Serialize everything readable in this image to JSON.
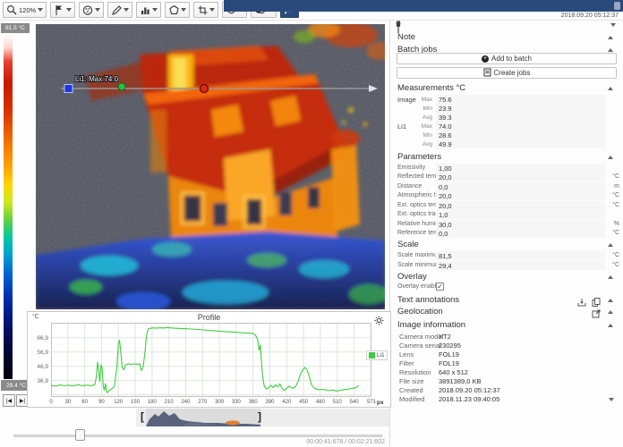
{
  "toolbar": {
    "zoom_value": "120%",
    "tools": [
      "zoom",
      "marker-flag",
      "palette",
      "pen",
      "histogram",
      "polygon",
      "crop",
      "rotate",
      "fade-overlay",
      "profile-chart"
    ]
  },
  "header": {
    "timestamp": "2018.09.20 05:12:37"
  },
  "scale_bar": {
    "max_label": "81.5 °C",
    "min_label": "29.4 °C"
  },
  "thermal_view": {
    "li1_label": "Li1: Max 74.0"
  },
  "transport": {
    "prev_label": "|◀",
    "next_label": "▶|",
    "time_label": "00:00:41:678 / 00:02:21:802",
    "bracket_left": "[",
    "bracket_right": "]"
  },
  "right_panel": {
    "note": {
      "title": "Note"
    },
    "batch_jobs": {
      "title": "Batch jobs",
      "add_label": "Add to batch",
      "create_label": "Create jobs"
    },
    "measurements": {
      "title": "Measurements °C",
      "rows": [
        {
          "name": "Image",
          "stat": "Max",
          "value": "75.6"
        },
        {
          "name": "",
          "stat": "Min",
          "value": "23.9"
        },
        {
          "name": "",
          "stat": "Avg",
          "value": "39.3"
        },
        {
          "name": "Li1",
          "stat": "Max",
          "value": "74.0"
        },
        {
          "name": "",
          "stat": "Min",
          "value": "28.6"
        },
        {
          "name": "",
          "stat": "Avg",
          "value": "49.9"
        }
      ]
    },
    "parameters": {
      "title": "Parameters",
      "rows": [
        {
          "label": "Emissivity",
          "value": "1,00",
          "unit": ""
        },
        {
          "label": "Reflected temp.",
          "value": "20,0",
          "unit": "°C"
        },
        {
          "label": "Distance",
          "value": "0,0",
          "unit": "m"
        },
        {
          "label": "Atmospheric temp.",
          "value": "20,0",
          "unit": "°C"
        },
        {
          "label": "Ext. optics temp.",
          "value": "20,0",
          "unit": "°C"
        },
        {
          "label": "Ext. optics trans.",
          "value": "1,0",
          "unit": ""
        },
        {
          "label": "Relative humidity",
          "value": "30,0",
          "unit": "%"
        },
        {
          "label": "Reference temp.",
          "value": "0,0",
          "unit": "°C"
        }
      ]
    },
    "scale": {
      "title": "Scale",
      "rows": [
        {
          "label": "Scale maximum",
          "value": "81,5",
          "unit": "°C"
        },
        {
          "label": "Scale minimum",
          "value": "29,4",
          "unit": "°C"
        }
      ]
    },
    "overlay": {
      "title": "Overlay",
      "checkbox_label": "Overlay enabled",
      "checked": true,
      "checkmark": "✓"
    },
    "text_annotations": {
      "title": "Text annotations"
    },
    "geolocation": {
      "title": "Geolocation"
    },
    "image_information": {
      "title": "Image information",
      "rows": [
        {
          "label": "Camera model",
          "value": "XT2"
        },
        {
          "label": "Camera serial",
          "value": "230295"
        },
        {
          "label": "Lens",
          "value": "FOL19"
        },
        {
          "label": "Filter",
          "value": "FOL19"
        },
        {
          "label": "Resolution",
          "value": "640 x 512"
        },
        {
          "label": "File size",
          "value": "3891389,0 KB"
        },
        {
          "label": "Created",
          "value": "2018.09.20 05:12:37"
        },
        {
          "label": "Modified",
          "value": "2018.11.23 09:40:05"
        }
      ]
    }
  },
  "chart_data": {
    "type": "line",
    "title": "Profile",
    "ylabel": "°C",
    "xlabel": "px",
    "grid": true,
    "legend_position": "right",
    "xlim": [
      0,
      571
    ],
    "ylim": [
      25.4,
      77.4
    ],
    "x_ticks": [
      0,
      30,
      60,
      90,
      120,
      150,
      180,
      210,
      240,
      270,
      300,
      330,
      360,
      390,
      420,
      450,
      480,
      510,
      540,
      571
    ],
    "y_ticks": [
      {
        "value": 66.9,
        "label": "66,9"
      },
      {
        "value": 56.9,
        "label": "56,9"
      },
      {
        "value": 46.9,
        "label": "46,9"
      },
      {
        "value": 36.9,
        "label": "36,9"
      }
    ],
    "y_grid": [
      26.9,
      36.9,
      46.9,
      56.9,
      66.9,
      76.9
    ],
    "series": [
      {
        "name": "Li1",
        "color": "#3fcc3f",
        "points": [
          [
            0,
            33.5
          ],
          [
            8,
            33
          ],
          [
            16,
            33.8
          ],
          [
            24,
            33.2
          ],
          [
            32,
            33.6
          ],
          [
            40,
            33.1
          ],
          [
            48,
            33.9
          ],
          [
            56,
            33.3
          ],
          [
            64,
            33.7
          ],
          [
            72,
            33.2
          ],
          [
            78,
            34
          ],
          [
            81,
            40
          ],
          [
            83,
            50
          ],
          [
            85,
            44
          ],
          [
            87,
            36
          ],
          [
            89,
            48
          ],
          [
            91,
            46
          ],
          [
            93,
            33
          ],
          [
            95,
            30
          ],
          [
            97,
            35
          ],
          [
            99,
            29
          ],
          [
            101,
            28.5
          ],
          [
            104,
            30
          ],
          [
            108,
            31
          ],
          [
            113,
            33
          ],
          [
            117,
            45
          ],
          [
            120,
            62
          ],
          [
            122,
            65.5
          ],
          [
            124,
            58
          ],
          [
            127,
            46
          ],
          [
            130,
            44.5
          ],
          [
            133,
            48
          ],
          [
            138,
            48.5
          ],
          [
            143,
            48.2
          ],
          [
            148,
            48.6
          ],
          [
            153,
            48.3
          ],
          [
            158,
            48.5
          ],
          [
            161,
            44
          ],
          [
            164,
            46
          ],
          [
            167,
            55
          ],
          [
            170,
            68
          ],
          [
            173,
            73
          ],
          [
            177,
            73.5
          ],
          [
            182,
            73.8
          ],
          [
            188,
            73.6
          ],
          [
            194,
            73.9
          ],
          [
            200,
            73.7
          ],
          [
            206,
            74
          ],
          [
            212,
            73.8
          ],
          [
            220,
            73.6
          ],
          [
            230,
            73.4
          ],
          [
            240,
            73.2
          ],
          [
            250,
            73
          ],
          [
            260,
            72.7
          ],
          [
            270,
            72.4
          ],
          [
            280,
            72.1
          ],
          [
            290,
            71.8
          ],
          [
            300,
            71.5
          ],
          [
            310,
            71.2
          ],
          [
            320,
            71
          ],
          [
            330,
            70.7
          ],
          [
            340,
            70.4
          ],
          [
            350,
            70.2
          ],
          [
            358,
            70
          ],
          [
            364,
            69
          ],
          [
            368,
            66
          ],
          [
            371,
            58
          ],
          [
            373,
            62
          ],
          [
            375,
            50
          ],
          [
            377,
            40
          ],
          [
            380,
            33
          ],
          [
            384,
            31
          ],
          [
            388,
            32
          ],
          [
            392,
            33.5
          ],
          [
            396,
            32
          ],
          [
            400,
            34
          ],
          [
            404,
            32.5
          ],
          [
            408,
            34.5
          ],
          [
            412,
            31
          ],
          [
            416,
            30
          ],
          [
            420,
            31.5
          ],
          [
            424,
            33
          ],
          [
            428,
            32
          ],
          [
            432,
            31.5
          ],
          [
            436,
            33
          ],
          [
            440,
            36
          ],
          [
            444,
            41
          ],
          [
            448,
            44
          ],
          [
            452,
            46
          ],
          [
            456,
            44.5
          ],
          [
            460,
            40
          ],
          [
            464,
            34
          ],
          [
            468,
            32
          ],
          [
            472,
            31
          ],
          [
            478,
            30.5
          ],
          [
            484,
            30.8
          ],
          [
            490,
            30.2
          ],
          [
            496,
            29.8
          ],
          [
            502,
            30.3
          ],
          [
            508,
            29.6
          ],
          [
            514,
            29.9
          ],
          [
            520,
            30.5
          ],
          [
            526,
            30.8
          ],
          [
            532,
            31
          ],
          [
            538,
            31.5
          ],
          [
            544,
            32
          ],
          [
            548,
            33.5
          ]
        ]
      }
    ]
  }
}
